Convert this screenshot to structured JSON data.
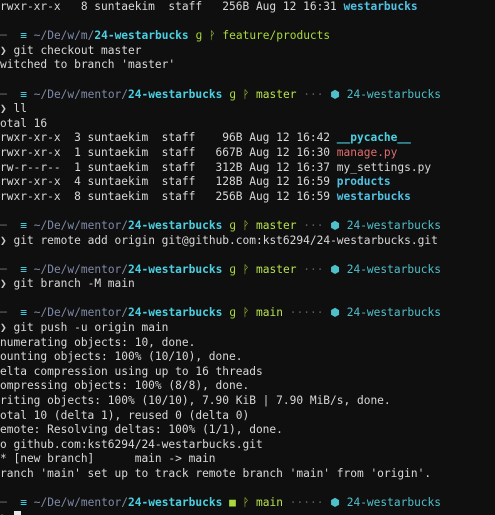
{
  "terminal": {
    "top_line": "rwxr-xr-x   8 suntaekim  staff   256B Aug 12 16:31 ",
    "top_line_dir": "westarbucks",
    "prompts": [
      {
        "path_prefix": "~/De/w/m/",
        "dir": "24-westarbucks",
        "git_icon": "git-icon",
        "branch": "feature/products",
        "right": ""
      },
      {
        "path_prefix": "~/De/w/mentor/",
        "dir": "24-westarbucks",
        "branch": "master",
        "right": "24-westarbucks"
      },
      {
        "path_prefix": "~/De/w/mentor/",
        "dir": "24-westarbucks",
        "branch": "master",
        "right": "24-westarbucks"
      },
      {
        "path_prefix": "~/De/w/mentor/",
        "dir": "24-westarbucks",
        "branch": "master",
        "right": "24-westarbucks"
      },
      {
        "path_prefix": "~/De/w/mentor/",
        "dir": "24-westarbucks",
        "branch": "main",
        "right": "24-westarbucks"
      },
      {
        "path_prefix": "~/De/w/mentor/",
        "dir": "24-westarbucks",
        "branch": "main",
        "right": "24-westarbucks"
      }
    ],
    "commands": {
      "checkout": "git checkout master",
      "checkout_out": "witched to branch 'master'",
      "ll": "ll",
      "ll_total": "otal 16",
      "remote": "git remote add origin git@github.com:kst6294/24-westarbucks.git",
      "branch": "git branch -M main",
      "push": "git push -u origin main"
    },
    "ll_rows": [
      {
        "prefix": "rwxr-xr-x  3 suntaekim  staff    96B Aug 12 16:42 ",
        "name": "__pycache__",
        "style": "py"
      },
      {
        "prefix": "rwxr-xr-x  1 suntaekim  staff   667B Aug 12 16:30 ",
        "name": "manage.py",
        "style": "red"
      },
      {
        "prefix": "rw-r--r--  1 suntaekim  staff   312B Aug 12 16:37 ",
        "name": "my_settings.py",
        "style": "plain"
      },
      {
        "prefix": "rwxr-xr-x  4 suntaekim  staff   128B Aug 12 16:59 ",
        "name": "products",
        "style": "dirblue"
      },
      {
        "prefix": "rwxr-xr-x  8 suntaekim  staff   256B Aug 12 16:59 ",
        "name": "westarbucks",
        "style": "dirblue"
      }
    ],
    "push_output": [
      "numerating objects: 10, done.",
      "ounting objects: 100% (10/10), done.",
      "elta compression using up to 16 threads",
      "ompressing objects: 100% (8/8), done.",
      "riting objects: 100% (10/10), 7.90 KiB | 7.90 MiB/s, done.",
      "otal 10 (delta 1), reused 0 (delta 0)",
      "emote: Resolving deltas: 100% (1/1), done.",
      "o github.com:kst6294/24-westarbucks.git",
      "* [new branch]      main -> main",
      "ranch 'main' set up to track remote branch 'main' from 'origin'."
    ],
    "glyphs": {
      "apple": "",
      "folder": "▬",
      "git": "⎇",
      "branch": "ᛘ",
      "chevron": "❯",
      "dots": "···",
      "dots_long": "·····",
      "node": "⬢"
    }
  }
}
